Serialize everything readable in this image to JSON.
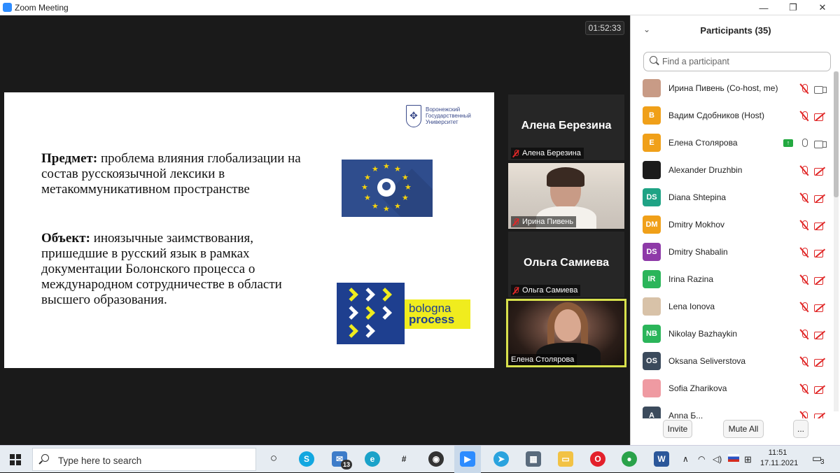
{
  "window": {
    "title": "Zoom Meeting",
    "minimize": "—",
    "maximize": "❐",
    "close": "✕"
  },
  "meeting": {
    "timer": "01:52:33"
  },
  "slide": {
    "logo_text": "Воронежский\nГосударственный\nУниверситет",
    "subject_label": "Предмет:",
    "subject_text": " проблема влияния глобализации на состав русскоязычной лексики в метакоммуникативном пространстве",
    "object_label": "Объект:",
    "object_text": " иноязычные заимствования, пришедшие в русский язык в рамках документации Болонского процесса о международном сотрудничестве в области высшего образования.",
    "bologna_line1": "bologna",
    "bologna_line2": "process"
  },
  "video_tiles": [
    {
      "display": "Алена Березина",
      "label": "Алена Березина",
      "muted": true,
      "video": false
    },
    {
      "display": "",
      "label": "Ирина Пивень",
      "muted": true,
      "video": true
    },
    {
      "display": "Ольга Самиева",
      "label": "Ольга Самиева",
      "muted": true,
      "video": false
    },
    {
      "display": "",
      "label": "Елена Столярова",
      "muted": false,
      "video": true,
      "active_speaker": true
    }
  ],
  "participants_panel": {
    "title": "Participants (35)",
    "search_placeholder": "Find a participant",
    "items": [
      {
        "name": "Ирина Пивень (Co-host, me)",
        "initials": "",
        "color": "#c89b86",
        "mic": "off",
        "cam": "on"
      },
      {
        "name": "Вадим Сдобников (Host)",
        "initials": "B",
        "color": "#f0a019",
        "mic": "off",
        "cam": "off"
      },
      {
        "name": "Елена Столярова",
        "initials": "E",
        "color": "#f0a019",
        "mic": "on",
        "cam": "on",
        "sharing": true
      },
      {
        "name": "Alexander Druzhbin",
        "initials": "",
        "color": "#1b1b1b",
        "mic": "off",
        "cam": "off"
      },
      {
        "name": "Diana Shtepina",
        "initials": "DS",
        "color": "#1fa385",
        "mic": "off",
        "cam": "off"
      },
      {
        "name": "Dmitry Mokhov",
        "initials": "DM",
        "color": "#f0a019",
        "mic": "off",
        "cam": "off"
      },
      {
        "name": "Dmitry Shabalin",
        "initials": "DS",
        "color": "#8e3aa8",
        "mic": "off",
        "cam": "off"
      },
      {
        "name": "Irina Razina",
        "initials": "IR",
        "color": "#2bb55a",
        "mic": "off",
        "cam": "off"
      },
      {
        "name": "Lena Ionova",
        "initials": "",
        "color": "#d8c2a8",
        "mic": "off",
        "cam": "off"
      },
      {
        "name": "Nikolay Bazhaykin",
        "initials": "NB",
        "color": "#2bb55a",
        "mic": "off",
        "cam": "off"
      },
      {
        "name": "Oksana Seliverstova",
        "initials": "OS",
        "color": "#3b4a5c",
        "mic": "off",
        "cam": "off"
      },
      {
        "name": "Sofia Zharikova",
        "initials": "",
        "color": "#ef9aa2",
        "mic": "off",
        "cam": "off"
      },
      {
        "name": "Anna Б...",
        "initials": "A",
        "color": "#3b4a5c",
        "mic": "off",
        "cam": "off"
      }
    ],
    "buttons": {
      "invite": "Invite",
      "mute_all": "Mute All",
      "more": "..."
    }
  },
  "taskbar": {
    "search_placeholder": "Type here to search",
    "mail_badge": "13",
    "time": "11:51",
    "date": "17.11.2021",
    "notification_count": "3",
    "language": "🇷🇺"
  }
}
